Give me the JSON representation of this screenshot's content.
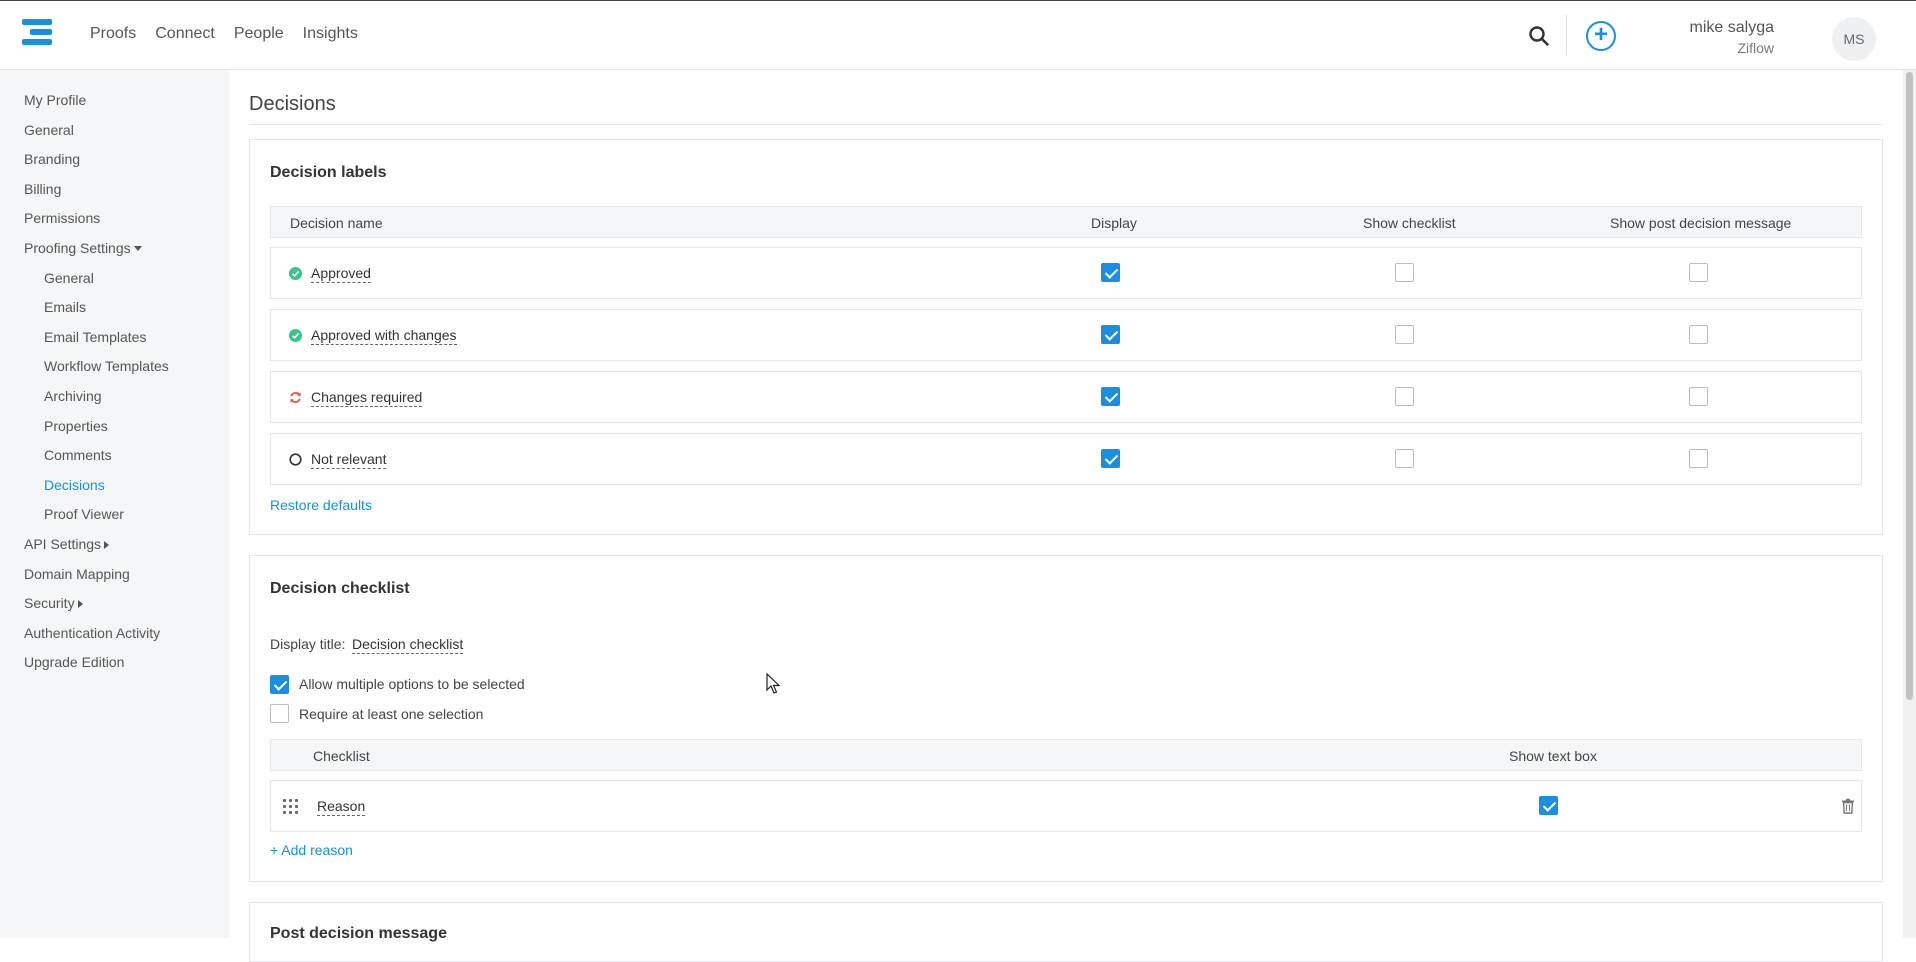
{
  "header": {
    "nav": [
      "Proofs",
      "Connect",
      "People",
      "Insights"
    ],
    "user_name": "mike salyga",
    "user_org": "Ziflow",
    "avatar_initials": "MS",
    "accent_color": "#1a8fe0"
  },
  "sidebar": {
    "items": [
      {
        "label": "My Profile"
      },
      {
        "label": "General"
      },
      {
        "label": "Branding"
      },
      {
        "label": "Billing"
      },
      {
        "label": "Permissions"
      },
      {
        "label": "Proofing Settings"
      },
      {
        "label": "General"
      },
      {
        "label": "Emails"
      },
      {
        "label": "Email Templates"
      },
      {
        "label": "Workflow Templates"
      },
      {
        "label": "Archiving"
      },
      {
        "label": "Properties"
      },
      {
        "label": "Comments"
      },
      {
        "label": "Decisions"
      },
      {
        "label": "Proof Viewer"
      },
      {
        "label": "API Settings"
      },
      {
        "label": "Domain Mapping"
      },
      {
        "label": "Security"
      },
      {
        "label": "Authentication Activity"
      },
      {
        "label": "Upgrade Edition"
      }
    ],
    "active": "Decisions"
  },
  "main": {
    "page_title": "Decisions",
    "decision_labels": {
      "title": "Decision labels",
      "columns": [
        "Decision name",
        "Display",
        "Show checklist",
        "Show post decision message"
      ],
      "rows": [
        {
          "name": "Approved",
          "icon": "check-circle-icon",
          "icon_color": "#3cc28f",
          "display": true,
          "show_checklist": false,
          "show_post_message": false
        },
        {
          "name": "Approved with changes",
          "icon": "check-circle-icon",
          "icon_color": "#3cc28f",
          "display": true,
          "show_checklist": false,
          "show_post_message": false
        },
        {
          "name": "Changes required",
          "icon": "refresh-icon",
          "icon_color": "#e8534a",
          "display": true,
          "show_checklist": false,
          "show_post_message": false
        },
        {
          "name": "Not relevant",
          "icon": "circle-outline-icon",
          "icon_color": "#333333",
          "display": true,
          "show_checklist": false,
          "show_post_message": false
        }
      ],
      "restore_label": "Restore defaults"
    },
    "decision_checklist": {
      "title": "Decision checklist",
      "display_title_label": "Display title:",
      "display_title_value": "Decision checklist",
      "options": [
        {
          "label": "Allow multiple options to be selected",
          "checked": true
        },
        {
          "label": "Require at least one selection",
          "checked": false
        }
      ],
      "columns": [
        "Checklist",
        "Show text box"
      ],
      "items": [
        {
          "name": "Reason",
          "show_text_box": true
        }
      ],
      "add_label": "+ Add reason"
    },
    "post_decision": {
      "title": "Post decision message"
    }
  }
}
